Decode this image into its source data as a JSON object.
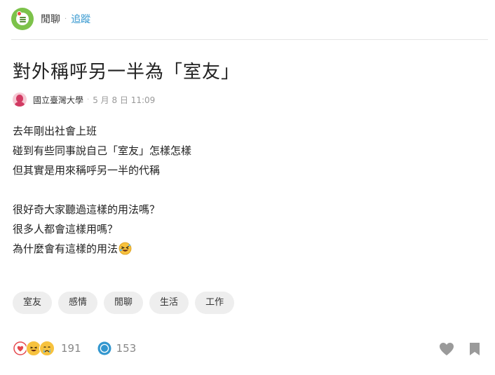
{
  "board": {
    "name": "閒聊",
    "separator": "·",
    "follow_label": "追蹤",
    "icon": "chat-bubble-icon",
    "icon_color": "#7cc24a"
  },
  "post": {
    "title": "對外稱呼另一半為「室友」",
    "author": {
      "school": "國立臺灣大學",
      "avatar_icon": "female-avatar-icon",
      "avatar_color": "#d23b63"
    },
    "meta_separator": "·",
    "date": "5 月 8 日 11:09",
    "body_lines": [
      "去年剛出社會上班",
      "碰到有些同事說自己「室友」怎樣怎樣",
      "但其實是用來稱呼另一半的代稱",
      "",
      "很好奇大家聽過這樣的用法嗎？",
      "很多人都會這樣用嗎？",
      "為什麼會有這樣的用法"
    ],
    "body_trailing_emoji": "rolling-laughing-emoji"
  },
  "tags": [
    "室友",
    "感情",
    "閒聊",
    "生活",
    "工作"
  ],
  "footer": {
    "reactions": [
      "heart-icon",
      "laughing-icon",
      "crying-icon"
    ],
    "reaction_count": "191",
    "comment_icon": "comment-bubble-icon",
    "comment_count": "153",
    "like_icon": "heart-outline-icon",
    "bookmark_icon": "bookmark-icon",
    "accent_color": "#3397cf",
    "muted_color": "#888888"
  }
}
